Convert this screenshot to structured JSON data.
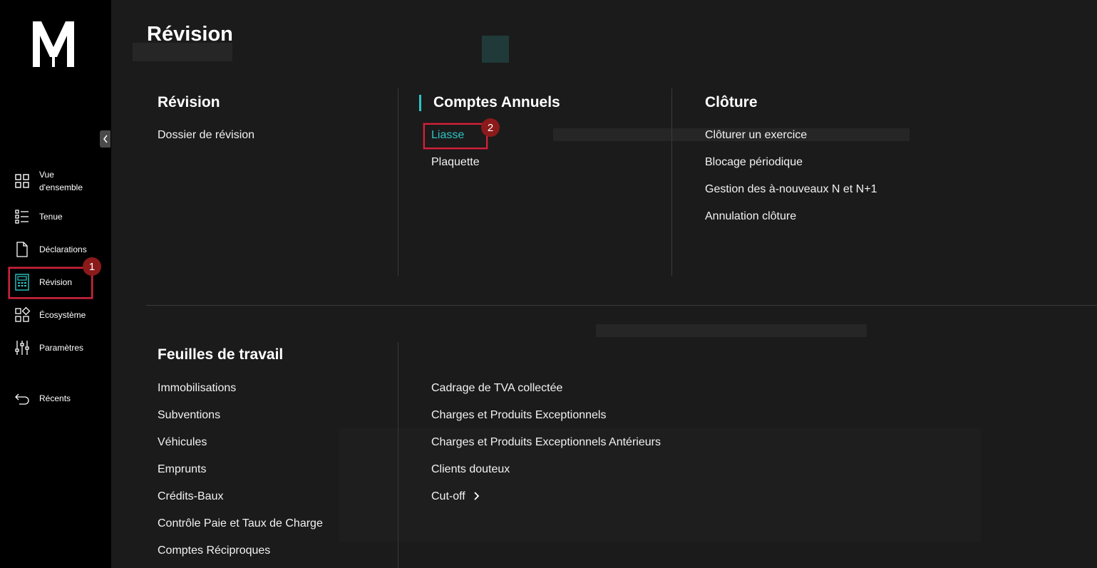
{
  "app": {
    "name": "M"
  },
  "colors": {
    "accent": "#2ec4c4",
    "highlight": "#d0243b",
    "badge": "#8b1a1a"
  },
  "sidebar": {
    "items": [
      {
        "label": "Vue d'ensemble",
        "icon": "grid-icon"
      },
      {
        "label": "Tenue",
        "icon": "list-icon"
      },
      {
        "label": "Déclarations",
        "icon": "document-icon"
      },
      {
        "label": "Révision",
        "icon": "calculator-icon",
        "active": true
      },
      {
        "label": "Écosystème",
        "icon": "ecosystem-icon"
      },
      {
        "label": "Paramètres",
        "icon": "sliders-icon"
      },
      {
        "label": "Récents",
        "icon": "back-arrow-icon"
      }
    ],
    "label_line1": "Vue",
    "label_line2": "d'ensemble"
  },
  "badges": {
    "step1": "1",
    "step2": "2"
  },
  "main": {
    "title": "Révision",
    "sections": {
      "revision": {
        "title": "Révision",
        "links": [
          "Dossier de révision"
        ]
      },
      "comptes": {
        "title": "Comptes Annuels",
        "links": [
          "Liasse",
          "Plaquette"
        ]
      },
      "cloture": {
        "title": "Clôture",
        "links": [
          "Clôturer un exercice",
          "Blocage périodique",
          "Gestion des à-nouveaux N et N+1",
          "Annulation clôture"
        ]
      },
      "feuilles": {
        "title": "Feuilles de travail",
        "col1": [
          "Immobilisations",
          "Subventions",
          "Véhicules",
          "Emprunts",
          "Crédits-Baux",
          "Contrôle Paie et Taux de Charge",
          "Comptes Réciproques"
        ],
        "col2": [
          "Cadrage de TVA collectée",
          "Charges et Produits Exceptionnels",
          "Charges et Produits Exceptionnels Antérieurs",
          "Clients douteux",
          "Cut-off"
        ]
      }
    }
  }
}
